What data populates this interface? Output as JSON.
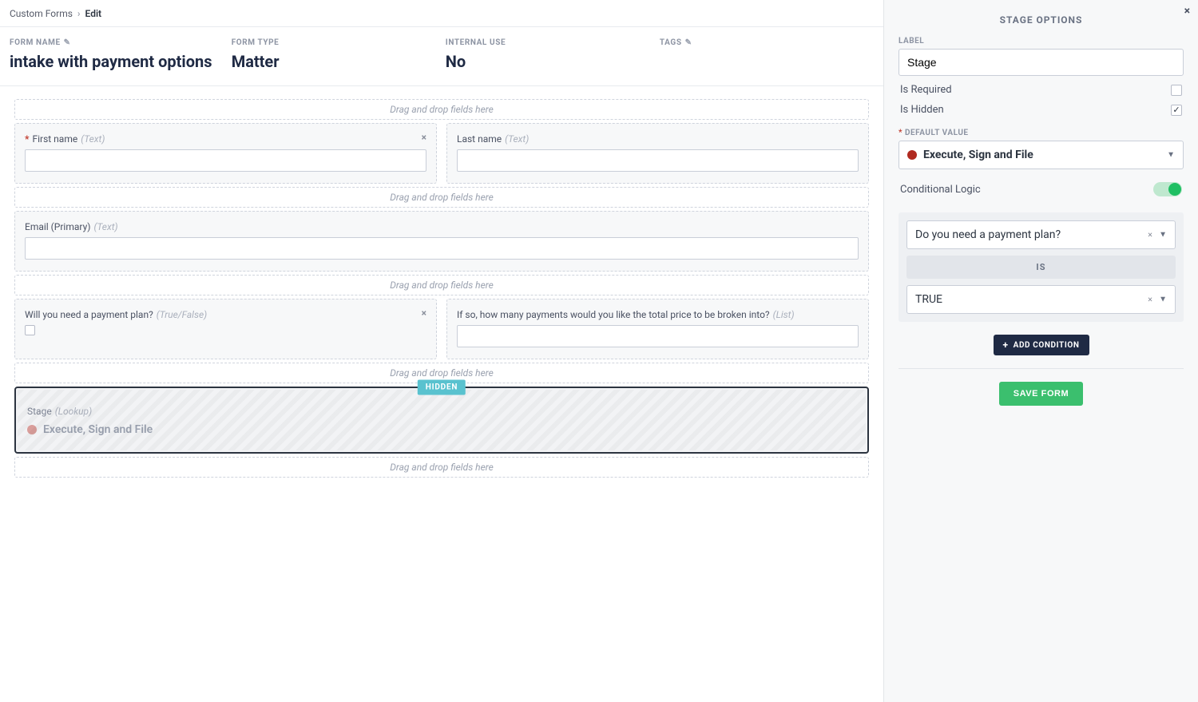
{
  "breadcrumb": {
    "root": "Custom Forms",
    "current": "Edit"
  },
  "meta": {
    "formNameLabel": "FORM NAME",
    "formName": "intake with payment options",
    "formTypeLabel": "FORM TYPE",
    "formType": "Matter",
    "internalUseLabel": "INTERNAL USE",
    "internalUse": "No",
    "tagsLabel": "TAGS"
  },
  "canvas": {
    "dropText": "Drag and drop fields here",
    "firstName": {
      "label": "First name",
      "type": "(Text)",
      "required": true
    },
    "lastName": {
      "label": "Last name",
      "type": "(Text)"
    },
    "email": {
      "label": "Email (Primary)",
      "type": "(Text)"
    },
    "paymentPlan": {
      "label": "Will you need a payment plan?",
      "type": "(True/False)"
    },
    "numPayments": {
      "label": "If so, how many payments would you like the total price to be broken into?",
      "type": "(List)"
    },
    "stage": {
      "label": "Stage",
      "type": "(Lookup)",
      "hiddenBadge": "HIDDEN",
      "value": "Execute, Sign and File"
    }
  },
  "panel": {
    "title": "STAGE OPTIONS",
    "labelLabel": "LABEL",
    "labelValue": "Stage",
    "isRequired": "Is Required",
    "isHidden": "Is Hidden",
    "defaultValueLabel": "DEFAULT VALUE",
    "defaultValue": "Execute, Sign and File",
    "conditionalLogic": "Conditional Logic",
    "condField": "Do you need a payment plan?",
    "condOp": "IS",
    "condValue": "TRUE",
    "addCondition": "ADD CONDITION",
    "saveForm": "SAVE FORM"
  }
}
